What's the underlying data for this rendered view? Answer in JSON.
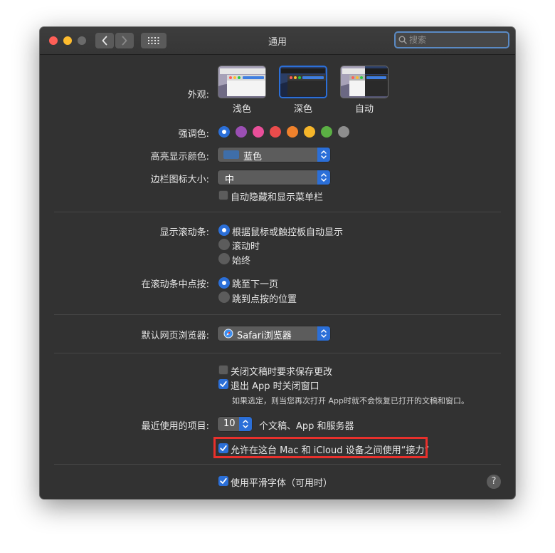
{
  "window": {
    "title": "通用"
  },
  "search": {
    "placeholder": "搜索"
  },
  "appearance": {
    "label": "外观:",
    "options": [
      "浅色",
      "深色",
      "自动"
    ],
    "selected": "深色"
  },
  "accent": {
    "label": "强调色:",
    "colors": [
      "#2b6fd8",
      "#9b4fb4",
      "#e94f9a",
      "#ea4c4c",
      "#f0822c",
      "#f6b62a",
      "#5bb044",
      "#8e8e8e"
    ],
    "selected_index": 0
  },
  "highlight_color": {
    "label": "高亮显示颜色:",
    "value": "蓝色",
    "swatch": "#3f6ea8"
  },
  "sidebar_icon_size": {
    "label": "边栏图标大小:",
    "value": "中"
  },
  "menu_bar": {
    "label": "自动隐藏和显示菜单栏",
    "checked": false
  },
  "scroll_bars": {
    "label": "显示滚动条:",
    "options": [
      "根据鼠标或触控板自动显示",
      "滚动时",
      "始终"
    ],
    "selected_index": 0
  },
  "click_scroll_bar": {
    "label": "在滚动条中点按:",
    "options": [
      "跳至下一页",
      "跳到点按的位置"
    ],
    "selected_index": 0
  },
  "default_browser": {
    "label": "默认网页浏览器:",
    "value": "Safari浏览器"
  },
  "documents": {
    "ask_keep_changes": {
      "label": "关闭文稿时要求保存更改",
      "checked": false
    },
    "close_windows": {
      "label": "退出 App 时关闭窗口",
      "checked": true
    },
    "note": "如果选定，则当您再次打开 App时就不会恢复已打开的文稿和窗口。"
  },
  "recent_items": {
    "label": "最近使用的项目:",
    "value": "10",
    "suffix": "个文稿、App 和服务器"
  },
  "handoff": {
    "label": "允许在这台 Mac 和 iCloud 设备之间使用“接力”",
    "checked": true
  },
  "font_smoothing": {
    "label": "使用平滑字体（可用时）",
    "checked": true
  },
  "help": {
    "label": "?"
  },
  "colors": {
    "accent": "#2b6fd8",
    "highlight_box": "#e8302c",
    "window_bg": "#323232"
  }
}
